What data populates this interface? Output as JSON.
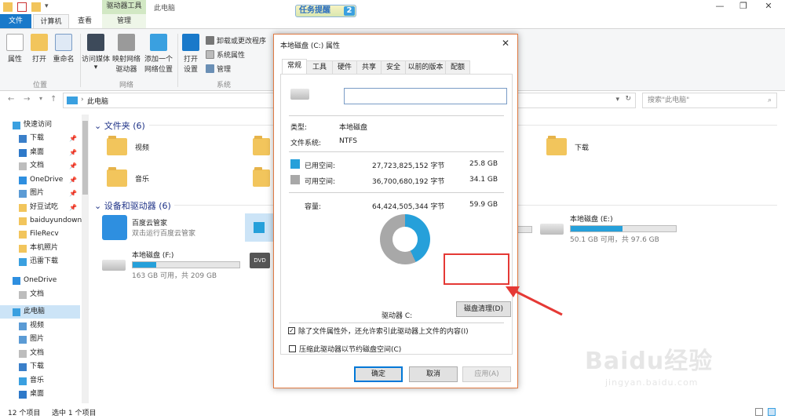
{
  "window": {
    "context_tab": "驱动器工具",
    "title": "此电脑",
    "controls": {
      "minimize": "—",
      "restore": "❐",
      "close": "✕"
    },
    "badge": {
      "label": "任务提醒",
      "count": "2"
    }
  },
  "ribbon_tabs": {
    "file": "文件",
    "computer": "计算机",
    "view": "查看",
    "manage": "管理"
  },
  "ribbon": {
    "location": {
      "properties": "属性",
      "open": "打开",
      "rename": "重命名",
      "group": "位置"
    },
    "network": {
      "access_media": "访问媒体",
      "map_drive_1": "映射网络",
      "map_drive_2": "驱动器",
      "add_location_1": "添加一个",
      "add_location_2": "网络位置",
      "group": "网络"
    },
    "system": {
      "open_settings_1": "打开",
      "open_settings_2": "设置",
      "uninstall": "卸载或更改程序",
      "system_props": "系统属性",
      "manage": "管理",
      "group": "系统"
    }
  },
  "address": {
    "path": "此电脑",
    "search_placeholder": "搜索\"此电脑\""
  },
  "sidebar": [
    {
      "label": "快速访问",
      "pinned": false
    },
    {
      "label": "下载",
      "pinned": true
    },
    {
      "label": "桌面",
      "pinned": true
    },
    {
      "label": "文档",
      "pinned": true
    },
    {
      "label": "OneDrive",
      "pinned": true
    },
    {
      "label": "图片",
      "pinned": true
    },
    {
      "label": "好豆试吃",
      "pinned": true
    },
    {
      "label": "baiduyundown",
      "pinned": false
    },
    {
      "label": "FileRecv",
      "pinned": false
    },
    {
      "label": "本机照片",
      "pinned": false
    },
    {
      "label": "迅雷下载",
      "pinned": false
    },
    {
      "label": "OneDrive",
      "pinned": false
    },
    {
      "label": "文档",
      "pinned": false
    },
    {
      "label": "此电脑",
      "pinned": false
    },
    {
      "label": "视频",
      "pinned": false
    },
    {
      "label": "图片",
      "pinned": false
    },
    {
      "label": "文档",
      "pinned": false
    },
    {
      "label": "下载",
      "pinned": false
    },
    {
      "label": "音乐",
      "pinned": false
    },
    {
      "label": "桌面",
      "pinned": false
    }
  ],
  "pin_glyph": "📌",
  "content": {
    "folders_header": "文件夹 (6)",
    "folders": {
      "videos": "视频",
      "music": "音乐",
      "downloads": "下载"
    },
    "devices_header": "设备和驱动器 (6)",
    "baidu": {
      "name": "百度云管家",
      "desc": "双击运行百度云管家"
    },
    "drive_e": {
      "name": "本地磁盘 (E:)",
      "usage": "50.1 GB 可用，共 97.6 GB",
      "used_fraction": 0.49
    },
    "drive_f": {
      "name": "本地磁盘 (F:)",
      "usage": "163 GB 可用，共 209 GB",
      "used_fraction": 0.22
    },
    "dvd_label": "DVD"
  },
  "status": {
    "items": "12 个项目",
    "selected": "选中 1 个项目"
  },
  "dialog": {
    "title": "本地磁盘 (C:) 属性",
    "close": "✕",
    "tabs": [
      "常规",
      "工具",
      "硬件",
      "共享",
      "安全",
      "以前的版本",
      "配额"
    ],
    "name_value": "",
    "type_label": "类型:",
    "type_value": "本地磁盘",
    "fs_label": "文件系统:",
    "fs_value": "NTFS",
    "used_label": "已用空间:",
    "used_bytes": "27,723,825,152 字节",
    "used_gb": "25.8 GB",
    "free_label": "可用空间:",
    "free_bytes": "36,700,680,192 字节",
    "free_gb": "34.1 GB",
    "capacity_label": "容量:",
    "capacity_bytes": "64,424,505,344 字节",
    "capacity_gb": "59.9 GB",
    "used_fraction": 0.43,
    "drive_label": "驱动器 C:",
    "cleanup_button": "磁盘清理(D)",
    "compress_label": "压缩此驱动器以节约磁盘空间(C)",
    "index_label": "除了文件属性外，还允许索引此驱动器上文件的内容(I)",
    "index_checked": "✓",
    "ok": "确定",
    "cancel": "取消",
    "apply": "应用(A)"
  },
  "colors": {
    "used": "#26a0da",
    "free": "#a8a8a8",
    "accent": "#1979ca",
    "highlight": "#e53935"
  },
  "watermark": {
    "logo": "Baidu经验",
    "url": "jingyan.baidu.com"
  }
}
